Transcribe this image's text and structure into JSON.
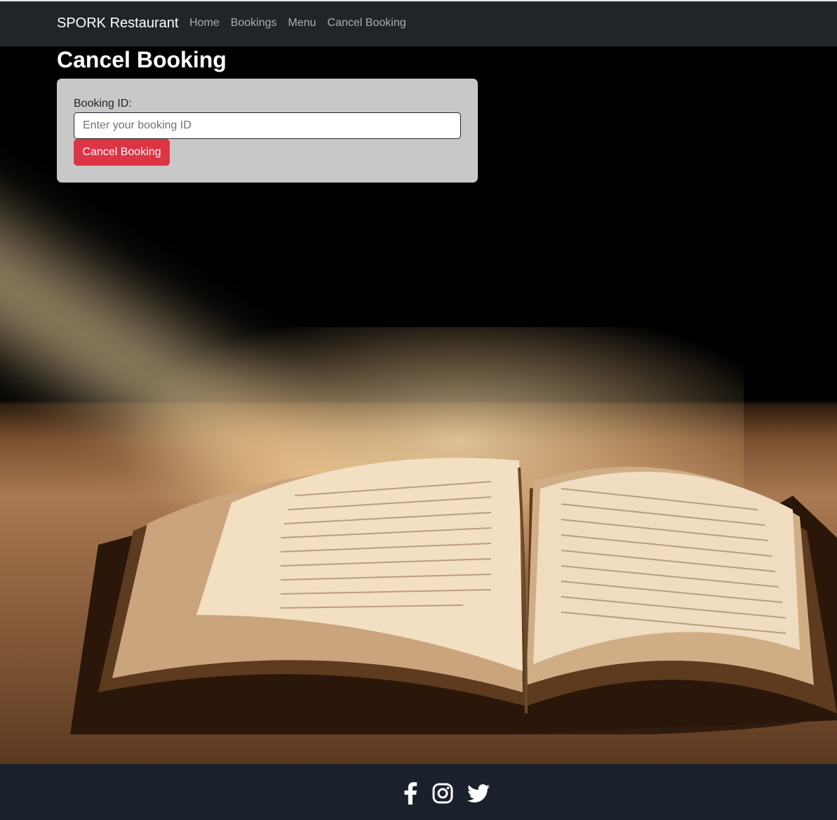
{
  "navbar": {
    "brand": "SPORK Restaurant",
    "links": [
      "Home",
      "Bookings",
      "Menu",
      "Cancel Booking"
    ]
  },
  "main": {
    "title": "Cancel Booking",
    "form": {
      "label": "Booking ID:",
      "input_value": "",
      "input_placeholder": "Enter your booking ID",
      "submit_label": "Cancel Booking"
    }
  },
  "footer": {
    "social_icons": [
      "facebook-icon",
      "instagram-icon",
      "twitter-icon"
    ]
  },
  "colors": {
    "navbar_bg": "#212529",
    "footer_bg": "#1b212c",
    "danger": "#dc3545"
  }
}
